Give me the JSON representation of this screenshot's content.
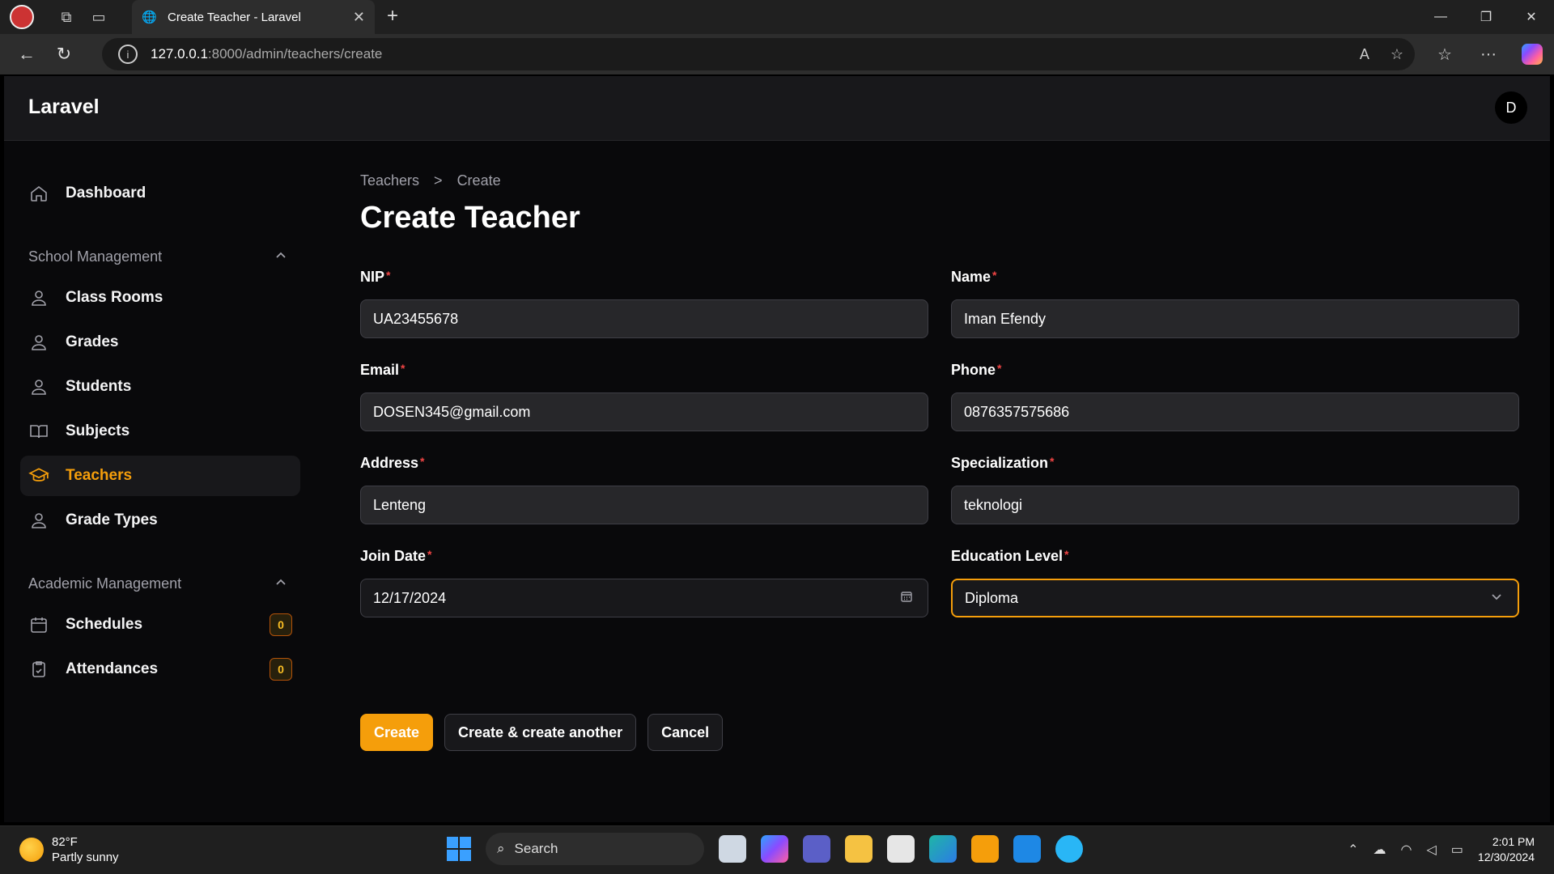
{
  "browser": {
    "tab_title": "Create Teacher - Laravel",
    "url_host": "127.0.0.1",
    "url_path": ":8000/admin/teachers/create"
  },
  "app": {
    "brand": "Laravel",
    "user_initial": "D"
  },
  "sidebar": {
    "dashboard": "Dashboard",
    "groups": [
      {
        "label": "School Management",
        "items": [
          "Class Rooms",
          "Grades",
          "Students",
          "Subjects",
          "Teachers",
          "Grade Types"
        ]
      },
      {
        "label": "Academic Management",
        "items": [
          "Schedules",
          "Attendances"
        ]
      }
    ],
    "active": "Teachers",
    "badges": {
      "schedules": "0",
      "attendances": "0"
    }
  },
  "breadcrumb": {
    "parent": "Teachers",
    "separator": ">",
    "current": "Create"
  },
  "page_title": "Create Teacher",
  "form": {
    "required_mark": "*",
    "nip": {
      "label": "NIP",
      "value": "UA23455678"
    },
    "name": {
      "label": "Name",
      "value": "Iman Efendy"
    },
    "email": {
      "label": "Email",
      "value": "DOSEN345@gmail.com"
    },
    "phone": {
      "label": "Phone",
      "value": "0876357575686"
    },
    "address": {
      "label": "Address",
      "value": "Lenteng"
    },
    "specialization": {
      "label": "Specialization",
      "value": "teknologi"
    },
    "join_date": {
      "label": "Join Date",
      "value": "12/17/2024"
    },
    "education_level": {
      "label": "Education Level",
      "value": "Diploma"
    }
  },
  "actions": {
    "create": "Create",
    "create_another": "Create & create another",
    "cancel": "Cancel"
  },
  "taskbar": {
    "weather_temp": "82°F",
    "weather_desc": "Partly sunny",
    "search": "Search",
    "time": "2:01 PM",
    "date": "12/30/2024"
  },
  "colors": {
    "accent": "#f59e0b",
    "required": "#ef4444",
    "bg": "#09090b"
  }
}
